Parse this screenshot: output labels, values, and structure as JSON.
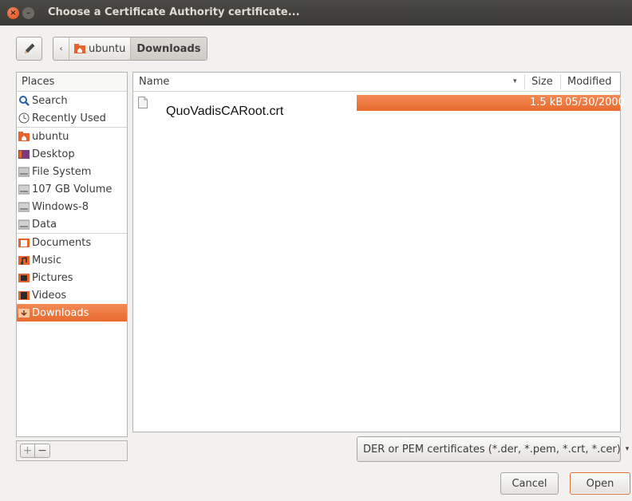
{
  "window": {
    "title": "Choose a Certificate Authority certificate..."
  },
  "titlebar": {
    "close_glyph": "×",
    "minimize_glyph": "–"
  },
  "icons": {
    "edit": "pencil-icon",
    "back": "chevron-left-icon",
    "home": "home-folder-icon",
    "file": "file-icon"
  },
  "pathbar": {
    "back_glyph": "‹",
    "items": [
      "ubuntu",
      "Downloads"
    ],
    "active": "Downloads"
  },
  "places": {
    "header": "Places",
    "groups": [
      [
        "Search",
        "Recently Used"
      ],
      [
        "ubuntu",
        "Desktop",
        "File System",
        "107 GB Volume",
        "Windows-8",
        "Data"
      ],
      [
        "Documents",
        "Music",
        "Pictures",
        "Videos",
        "Downloads"
      ]
    ],
    "selected": "Downloads",
    "add_glyph": "+",
    "remove_glyph": "−"
  },
  "files": {
    "columns": {
      "name": "Name",
      "sort_glyph": "▾",
      "size": "Size",
      "modified": "Modified"
    },
    "rows": [
      {
        "name": "QuoVadisCARoot.crt",
        "size": "1.5 kB",
        "modified": "05/30/2000"
      }
    ]
  },
  "filter": {
    "selected": "DER or PEM certificates (*.der, *.pem, *.crt, *.cer)",
    "arrow_glyph": "▾"
  },
  "buttons": {
    "cancel": "Cancel",
    "open": "Open"
  },
  "colors": {
    "selection": "#e86a2e",
    "titlebar": "#3c3b37",
    "window_bg": "#f2f1f0"
  }
}
